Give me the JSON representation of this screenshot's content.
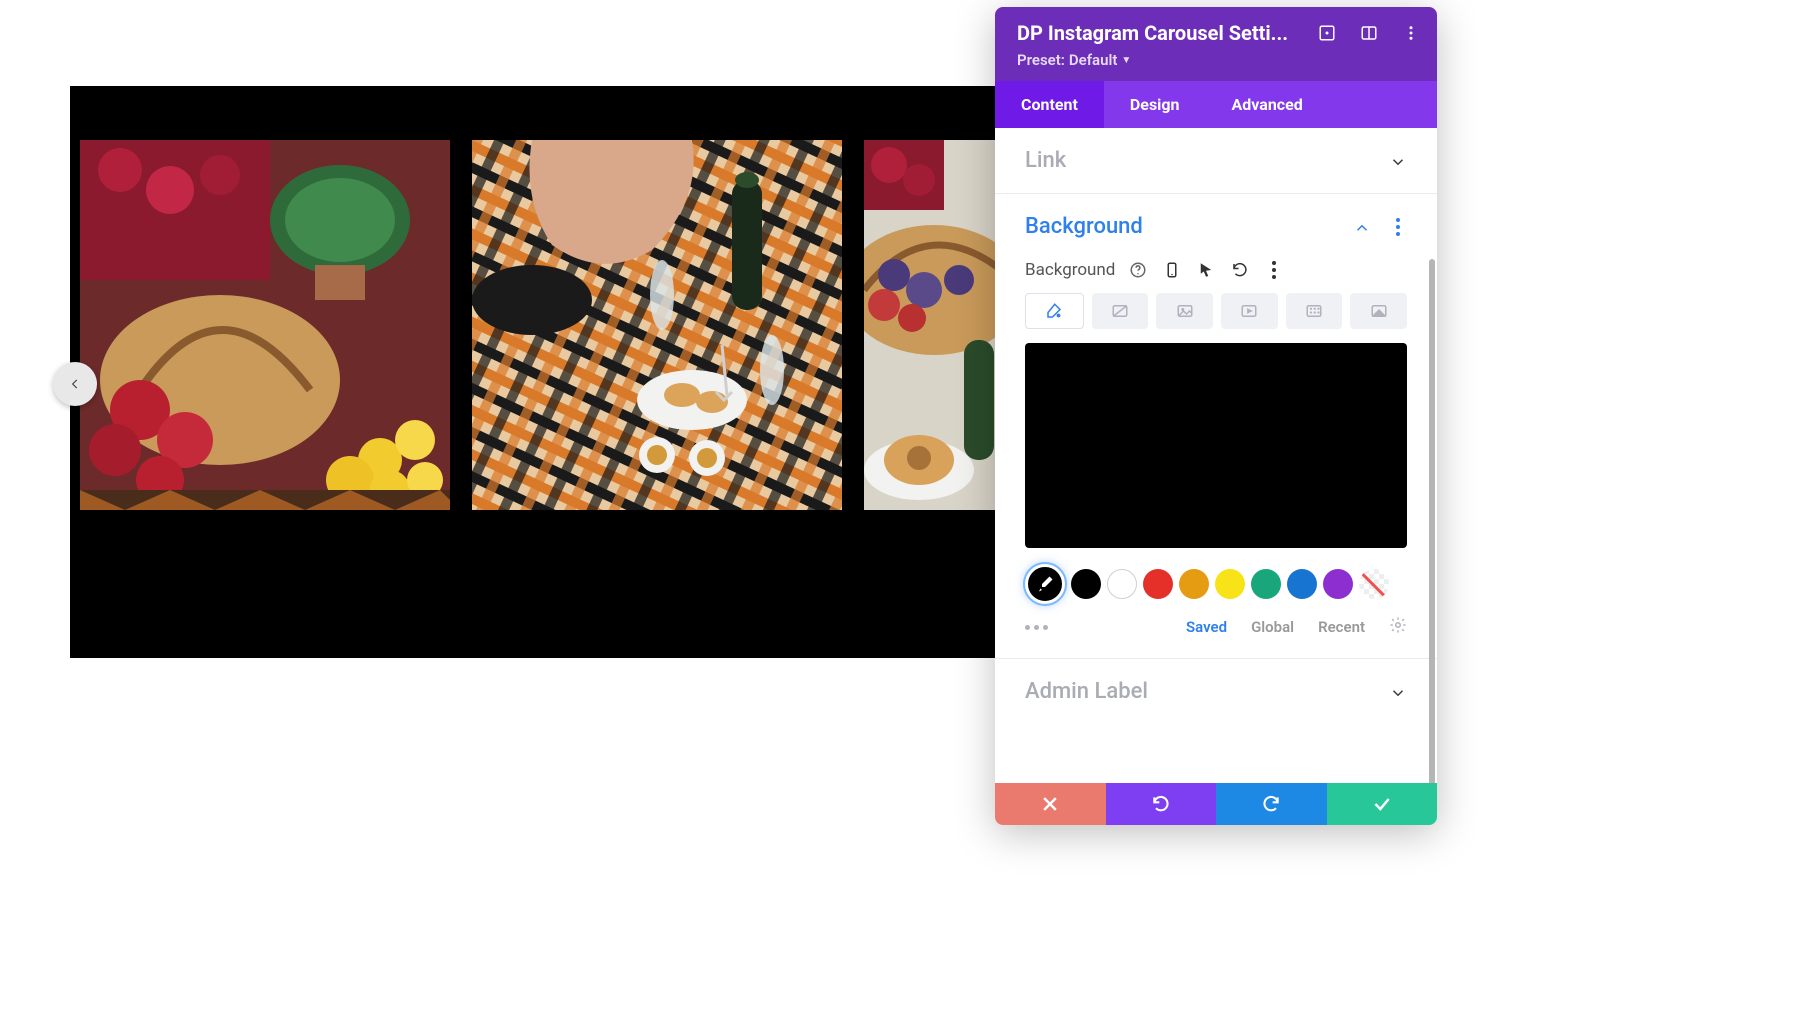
{
  "panel": {
    "title": "DP Instagram Carousel Setti...",
    "preset_label": "Preset:",
    "preset_value": "Default",
    "tabs": {
      "content": "Content",
      "design": "Design",
      "advanced": "Advanced"
    },
    "sections": {
      "link": "Link",
      "background": "Background",
      "admin_label": "Admin Label"
    },
    "background": {
      "label": "Background",
      "preview_color": "#000000",
      "type_tabs": [
        "color",
        "gradient",
        "image",
        "video",
        "pattern",
        "mask"
      ],
      "swatches": [
        "#000000",
        "#ffffff",
        "#e5302a",
        "#e69c12",
        "#f7e318",
        "#18a67a",
        "#1774d1",
        "#8d2fd0"
      ],
      "palette_tabs": {
        "saved": "Saved",
        "global": "Global",
        "recent": "Recent"
      }
    }
  },
  "carousel": {
    "background": "#000000"
  }
}
